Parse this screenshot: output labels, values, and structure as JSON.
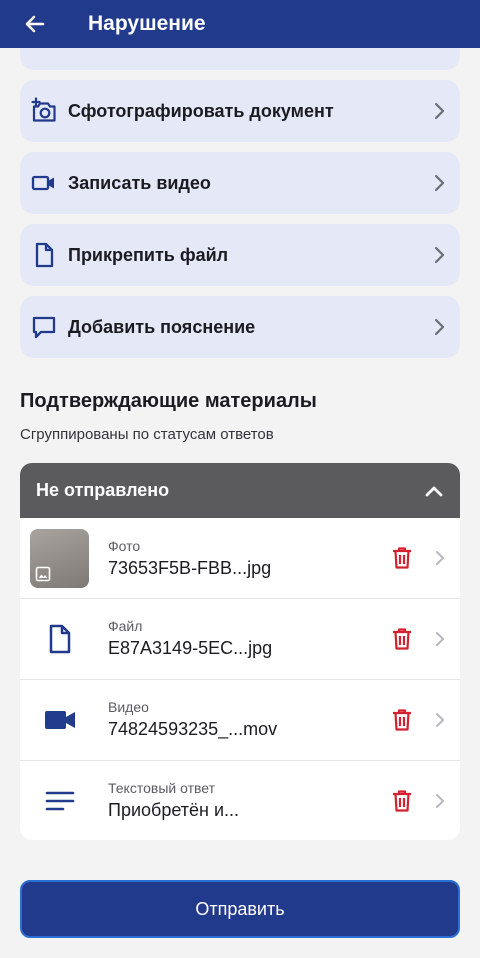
{
  "header": {
    "title": "Нарушение"
  },
  "actions": [
    {
      "label": "Сфотографировать документ",
      "icon": "camera-add-icon"
    },
    {
      "label": "Записать видео",
      "icon": "video-camera-icon"
    },
    {
      "label": "Прикрепить файл",
      "icon": "file-icon"
    },
    {
      "label": "Добавить пояснение",
      "icon": "comment-icon"
    }
  ],
  "section": {
    "title": "Подтверждающие материалы",
    "subtitle": "Сгруппированы по статусам ответов"
  },
  "group": {
    "title": "Не отправлено",
    "expanded": true
  },
  "items": [
    {
      "type": "Фото",
      "name": "73653F5B-FBB...jpg",
      "icon": "photo-thumbnail"
    },
    {
      "type": "Файл",
      "name": "E87A3149-5EC...jpg",
      "icon": "file-icon"
    },
    {
      "type": "Видео",
      "name": "74824593235_...mov",
      "icon": "video-camera-icon"
    },
    {
      "type": "Текстовый ответ",
      "name": "Приобретён и...",
      "icon": "text-lines-icon"
    }
  ],
  "submit": {
    "label": "Отправить"
  },
  "colors": {
    "primary": "#213a8c",
    "card": "#e4e8f7",
    "danger": "#d3222f",
    "group_header": "#5b5b5d"
  }
}
